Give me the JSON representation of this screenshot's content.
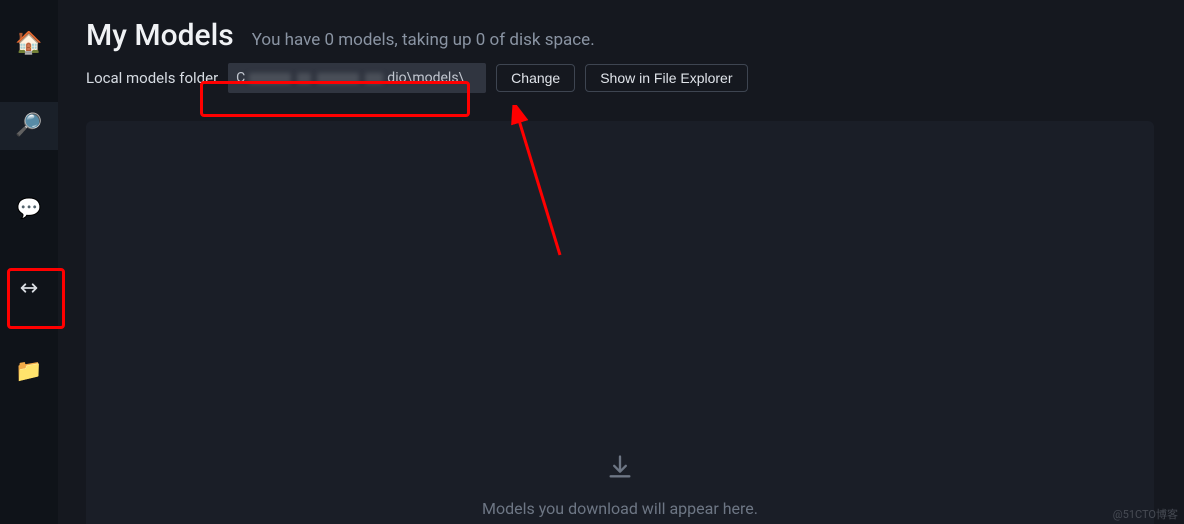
{
  "sidebar": {
    "items": [
      {
        "name": "home",
        "glyph": "🏠"
      },
      {
        "name": "search",
        "glyph": "🔎"
      },
      {
        "name": "chat",
        "glyph": "💬"
      },
      {
        "name": "local-server",
        "glyph": "↔"
      },
      {
        "name": "folder",
        "glyph": "📁"
      }
    ],
    "active": "search"
  },
  "header": {
    "title": "My Models",
    "subtitle": "You have 0 models, taking up 0 of disk space."
  },
  "folderRow": {
    "label": "Local models folder",
    "pathPrefix": "C",
    "pathSuffix": "dio\\models\\",
    "changeLabel": "Change",
    "showInExplorerLabel": "Show in File Explorer"
  },
  "emptyState": {
    "message": "Models you download will appear here."
  },
  "watermark": "@51CTO博客"
}
